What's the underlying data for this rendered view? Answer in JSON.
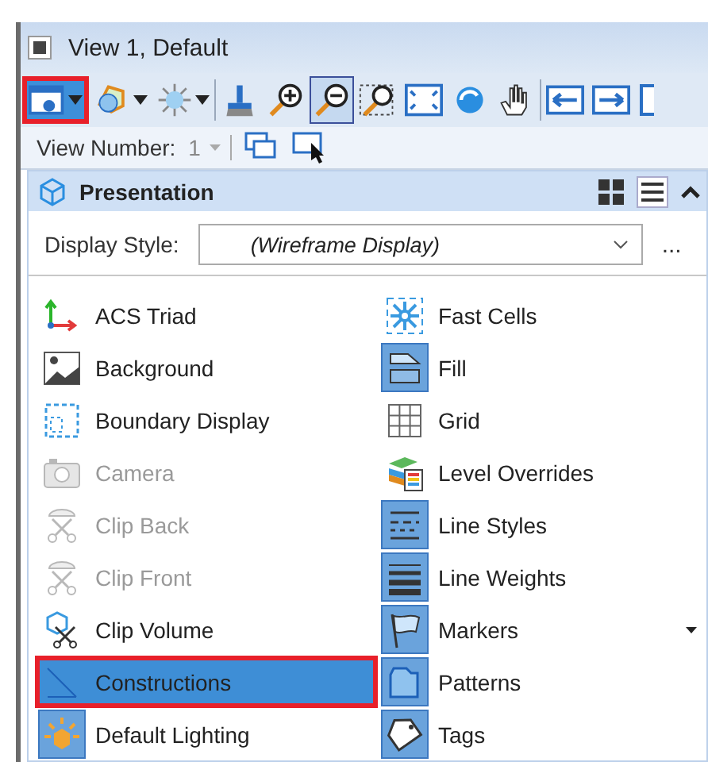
{
  "window": {
    "title": "View 1, Default"
  },
  "toolbar": {
    "buttons": [
      {
        "kind": "view-attributes",
        "dropdown": true,
        "highlighted": true,
        "pressed": false
      },
      {
        "kind": "display-style",
        "dropdown": true,
        "highlighted": false,
        "pressed": false
      },
      {
        "kind": "lights",
        "dropdown": true,
        "highlighted": false,
        "pressed": false
      },
      {
        "kind": "brush",
        "highlighted": false,
        "pressed": false
      },
      {
        "kind": "zoom-in",
        "highlighted": false,
        "pressed": false
      },
      {
        "kind": "zoom-out",
        "highlighted": false,
        "pressed": true
      },
      {
        "kind": "window-area",
        "highlighted": false,
        "pressed": false
      },
      {
        "kind": "fit-view",
        "highlighted": false,
        "pressed": false
      },
      {
        "kind": "rotate",
        "highlighted": false,
        "pressed": false
      },
      {
        "kind": "pan",
        "highlighted": false,
        "pressed": false
      },
      {
        "kind": "previous",
        "highlighted": false,
        "pressed": false
      },
      {
        "kind": "next",
        "highlighted": false,
        "pressed": false
      },
      {
        "kind": "more",
        "highlighted": false,
        "pressed": false
      }
    ]
  },
  "view_number": {
    "label": "View Number:",
    "value": "1"
  },
  "panel": {
    "title": "Presentation",
    "expanded": true,
    "display_style": {
      "label": "Display Style:",
      "value": "(Wireframe Display)",
      "more": "..."
    },
    "columns": [
      [
        {
          "label": "ACS Triad",
          "kind": "triad",
          "on": false,
          "disabled": false,
          "selected": false,
          "highlighted": false
        },
        {
          "label": "Background",
          "kind": "background",
          "on": false,
          "disabled": false,
          "selected": false,
          "highlighted": false
        },
        {
          "label": "Boundary Display",
          "kind": "boundary",
          "on": false,
          "disabled": false,
          "selected": false,
          "highlighted": false
        },
        {
          "label": "Camera",
          "kind": "camera",
          "on": false,
          "disabled": true,
          "selected": false,
          "highlighted": false
        },
        {
          "label": "Clip Back",
          "kind": "clip",
          "on": false,
          "disabled": true,
          "selected": false,
          "highlighted": false
        },
        {
          "label": "Clip Front",
          "kind": "clip",
          "on": false,
          "disabled": true,
          "selected": false,
          "highlighted": false
        },
        {
          "label": "Clip Volume",
          "kind": "clipvolume",
          "on": false,
          "disabled": false,
          "selected": false,
          "highlighted": false
        },
        {
          "label": "Constructions",
          "kind": "construction",
          "on": false,
          "disabled": false,
          "selected": true,
          "highlighted": true
        },
        {
          "label": "Default Lighting",
          "kind": "lighting",
          "on": true,
          "disabled": false,
          "selected": false,
          "highlighted": false
        }
      ],
      [
        {
          "label": "Fast Cells",
          "kind": "fastcells",
          "on": false,
          "disabled": false,
          "selected": false,
          "highlighted": false
        },
        {
          "label": "Fill",
          "kind": "fill",
          "on": true,
          "disabled": false,
          "selected": false,
          "highlighted": false
        },
        {
          "label": "Grid",
          "kind": "grid",
          "on": false,
          "disabled": false,
          "selected": false,
          "highlighted": false
        },
        {
          "label": "Level Overrides",
          "kind": "levels",
          "on": false,
          "disabled": false,
          "selected": false,
          "highlighted": false
        },
        {
          "label": "Line Styles",
          "kind": "linestyles",
          "on": true,
          "disabled": false,
          "selected": false,
          "highlighted": false
        },
        {
          "label": "Line Weights",
          "kind": "lineweights",
          "on": true,
          "disabled": false,
          "selected": false,
          "highlighted": false
        },
        {
          "label": "Markers",
          "kind": "markers",
          "on": true,
          "disabled": false,
          "selected": false,
          "highlighted": false,
          "dropdown": true
        },
        {
          "label": "Patterns",
          "kind": "patterns",
          "on": true,
          "disabled": false,
          "selected": false,
          "highlighted": false
        },
        {
          "label": "Tags",
          "kind": "tags",
          "on": true,
          "disabled": false,
          "selected": false,
          "highlighted": false
        }
      ]
    ]
  }
}
